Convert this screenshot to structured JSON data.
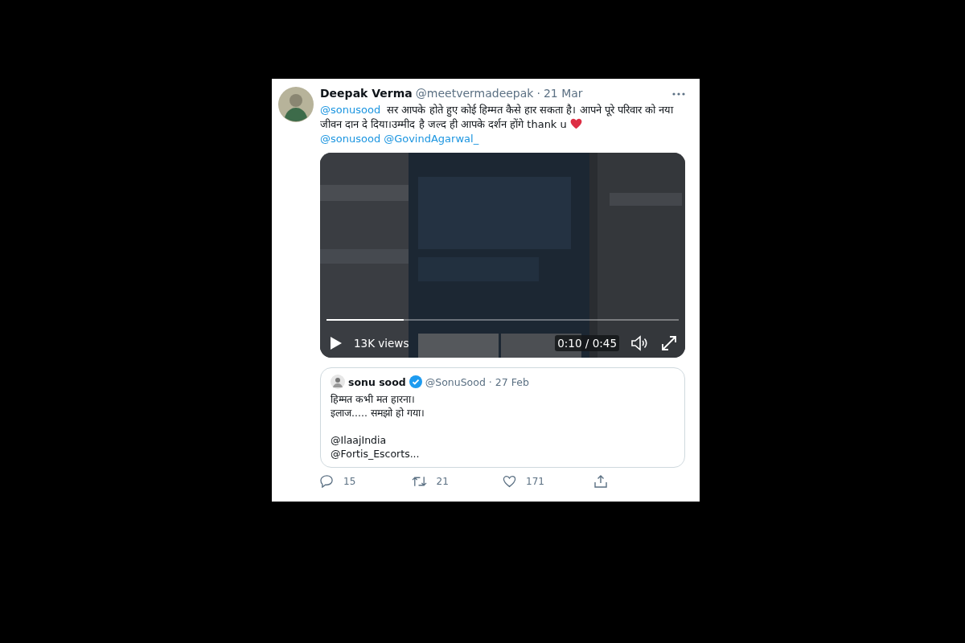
{
  "tweet": {
    "name": "Deepak Verma",
    "handle": "@meetvermadeepak",
    "dot": "·",
    "date": "21 Mar",
    "text": [
      {
        "kind": "mention",
        "text": "@sonusood"
      },
      {
        "kind": "text",
        "text": " सर आपके होते हुए कोई हिम्मत कैसे हार सकता है। आपने पूरे परिवार को नया जीवन दान दे दिया।उम्मीद है जल्द ही आपके दर्शन होंगे thank u "
      },
      {
        "kind": "heart"
      },
      {
        "kind": "mention",
        "text": "@sonusood"
      },
      {
        "kind": "mention",
        "text": "@GovindAgarwal_"
      }
    ],
    "video": {
      "kind": "picture",
      "level": 0.22,
      "views": "13K views",
      "time": "0:10 / 0:45"
    },
    "quote": {
      "name": "sonu sood",
      "verified": true,
      "handle": "@SonuSood",
      "dot": "·",
      "date": "27 Feb",
      "lines": [
        {
          "kind": "line",
          "text": "हिम्मत कभी मत हारना।"
        },
        {
          "kind": "line",
          "text": "इलाज..... समझो हो गया।"
        },
        {
          "kind": "gap"
        },
        {
          "kind": "line",
          "text": "@IlaajIndia"
        },
        {
          "kind": "line",
          "text": "@Fortis_Escorts..."
        }
      ]
    },
    "actions": [
      {
        "kind": "reply",
        "count": "15"
      },
      {
        "kind": "retweet",
        "count": "21"
      },
      {
        "kind": "like",
        "count": "171"
      },
      {
        "kind": "share"
      }
    ]
  }
}
